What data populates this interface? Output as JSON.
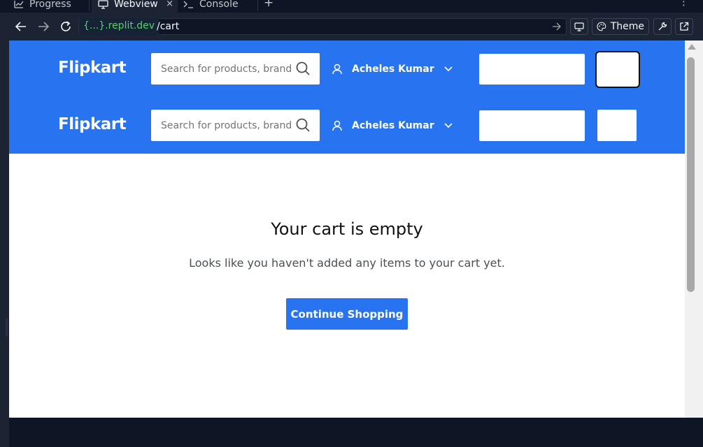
{
  "ide": {
    "tabs": [
      {
        "label": "Progress"
      },
      {
        "label": "Webview"
      },
      {
        "label": "Console"
      }
    ],
    "close_glyph": "×",
    "add_glyph": "+",
    "more_glyph": "⋮",
    "url": {
      "host": "{...}.replit.dev",
      "path": "/cart"
    },
    "theme_label": "Theme",
    "colors": {
      "bg": "#0e1525",
      "panel": "#1c2333",
      "host_green": "#58d068"
    }
  },
  "store": {
    "header_rows": [
      {
        "logo": "Flipkart",
        "search_placeholder": "Search for products, brands and more",
        "user_name": "Acheles Kumar"
      },
      {
        "logo": "Flipkart",
        "search_placeholder": "Search for products, brands and more",
        "user_name": "Acheles Kumar"
      }
    ],
    "empty_title": "Your cart is empty",
    "empty_desc": "Looks like you haven't added any items to your cart yet.",
    "continue_label": "Continue Shopping",
    "colors": {
      "brand_blue": "#2874f0",
      "white": "#ffffff"
    }
  }
}
